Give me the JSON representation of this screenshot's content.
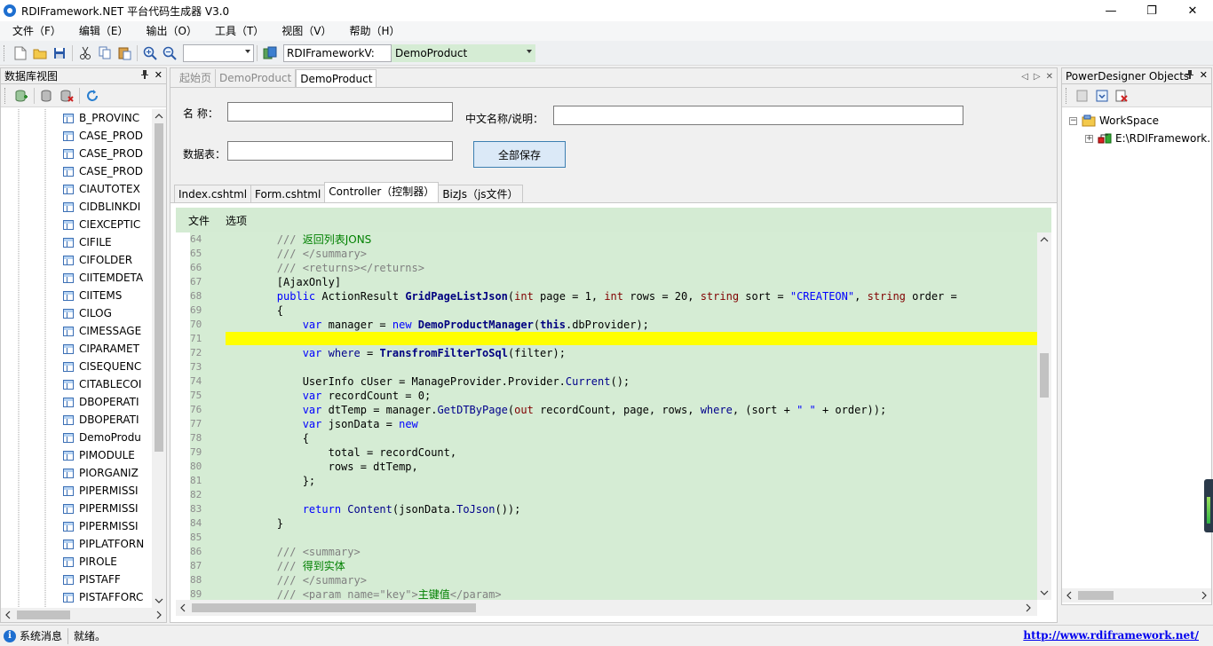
{
  "window": {
    "title": "RDIFramework.NET 平台代码生成器 V3.0",
    "minimize": "—",
    "maximize": "❐",
    "close": "✕"
  },
  "menu": [
    "文件（F）",
    "编辑（E）",
    "输出（O）",
    "工具（T）",
    "视图（V）",
    "帮助（H）"
  ],
  "toolbar": {
    "zoom_value": "",
    "project_combo": "RDIFrameworkV:",
    "table_combo": "DemoProduct"
  },
  "left_panel": {
    "title": "数据库视图",
    "pin": "📌",
    "close": "✕",
    "tables": [
      "B_PROVINC",
      "CASE_PROD",
      "CASE_PROD",
      "CASE_PROD",
      "CIAUTOTEX",
      "CIDBLINKDI",
      "CIEXCEPTIC",
      "CIFILE",
      "CIFOLDER",
      "CIITEMDETA",
      "CIITEMS",
      "CILOG",
      "CIMESSAGE",
      "CIPARAMET",
      "CISEQUENC",
      "CITABLECOI",
      "DBOPERATI",
      "DBOPERATI",
      "DemoProdu",
      "PIMODULE",
      "PIORGANIZ",
      "PIPERMISSI",
      "PIPERMISSI",
      "PIPERMISSI",
      "PIPLATFORN",
      "PIROLE",
      "PISTAFF",
      "PISTAFFORC"
    ]
  },
  "doc_tabs": {
    "tabs": [
      "起始页",
      "DemoProduct",
      "DemoProduct"
    ]
  },
  "form": {
    "name_label": "名  称：",
    "name_value": "",
    "cn_label": "中文名称/说明：",
    "cn_value": "",
    "table_label": "数据表：",
    "table_value": "",
    "save_label": "全部保存"
  },
  "sub_tabs": [
    "Index.cshtml",
    "Form.cshtml",
    "Controller（控制器）",
    "BizJs（js文件）"
  ],
  "editor_menu": [
    "文件",
    "选项"
  ],
  "code": {
    "highlight_line": 71,
    "lines": [
      {
        "n": "64",
        "html": "        <span class=\"c-com\">///</span> <span class=\"c-comtxt\">返回列表JONS</span>"
      },
      {
        "n": "65",
        "html": "        <span class=\"c-com\">/// &lt;/summary&gt;</span>"
      },
      {
        "n": "66",
        "html": "        <span class=\"c-com\">/// &lt;returns&gt;&lt;/returns&gt;</span>"
      },
      {
        "n": "67",
        "html": "        [AjaxOnly]"
      },
      {
        "n": "68",
        "html": "        <span class=\"c-kw\">public</span> ActionResult <span class=\"c-id2\">GridPageListJson</span>(<span class=\"c-kw2\">int</span> page = 1, <span class=\"c-kw2\">int</span> rows = 20, <span class=\"c-kw2\">string</span> sort = <span class=\"c-str\">\"CREATEON\"</span>, <span class=\"c-kw2\">string</span> order ="
      },
      {
        "n": "69",
        "html": "        {"
      },
      {
        "n": "70",
        "html": "            <span class=\"c-kw\">var</span> manager = <span class=\"c-kw\">new</span> <span class=\"c-id2\">DemoProductManager</span>(<span class=\"c-id2\">this</span>.dbProvider);"
      },
      {
        "n": "71",
        "html": ""
      },
      {
        "n": "72",
        "html": "            <span class=\"c-kw\">var</span> <span class=\"c-id\">where</span> = <span class=\"c-id2\">TransfromFilterToSql</span>(filter);"
      },
      {
        "n": "73",
        "html": ""
      },
      {
        "n": "74",
        "html": "            UserInfo cUser = ManageProvider.Provider.<span class=\"c-id\">Current</span>();"
      },
      {
        "n": "75",
        "html": "            <span class=\"c-kw\">var</span> recordCount = 0;"
      },
      {
        "n": "76",
        "html": "            <span class=\"c-kw\">var</span> dtTemp = manager.<span class=\"c-id\">GetDTByPage</span>(<span class=\"c-kw2\">out</span> recordCount, page, rows, <span class=\"c-id\">where</span>, (sort + <span class=\"c-str\">\" \"</span> + order));"
      },
      {
        "n": "77",
        "html": "            <span class=\"c-kw\">var</span> jsonData = <span class=\"c-kw\">new</span>"
      },
      {
        "n": "78",
        "html": "            {"
      },
      {
        "n": "79",
        "html": "                total = recordCount,"
      },
      {
        "n": "80",
        "html": "                rows = dtTemp,"
      },
      {
        "n": "81",
        "html": "            };"
      },
      {
        "n": "82",
        "html": ""
      },
      {
        "n": "83",
        "html": "            <span class=\"c-kw\">return</span> <span class=\"c-id\">Content</span>(jsonData.<span class=\"c-id\">ToJson</span>());"
      },
      {
        "n": "84",
        "html": "        }"
      },
      {
        "n": "85",
        "html": ""
      },
      {
        "n": "86",
        "html": "        <span class=\"c-com\">/// &lt;summary&gt;</span>"
      },
      {
        "n": "87",
        "html": "        <span class=\"c-com\">///</span> <span class=\"c-comtxt\">得到实体</span>"
      },
      {
        "n": "88",
        "html": "        <span class=\"c-com\">/// &lt;/summary&gt;</span>"
      },
      {
        "n": "89",
        "html": "        <span class=\"c-com\">/// &lt;param name=</span><span class=\"c-com\">\"key\"</span><span class=\"c-com\">&gt;</span><span class=\"c-comtxt\">主键值</span><span class=\"c-com\">&lt;/param&gt;</span>"
      }
    ]
  },
  "right_panel": {
    "title": "PowerDesigner Objects",
    "pin": "📌",
    "close": "✕",
    "workspace": "WorkSpace",
    "model": "E:\\RDIFramework."
  },
  "status": {
    "label": "系统消息",
    "message": "就绪。",
    "link": "http://www.rdiframework.net/"
  }
}
